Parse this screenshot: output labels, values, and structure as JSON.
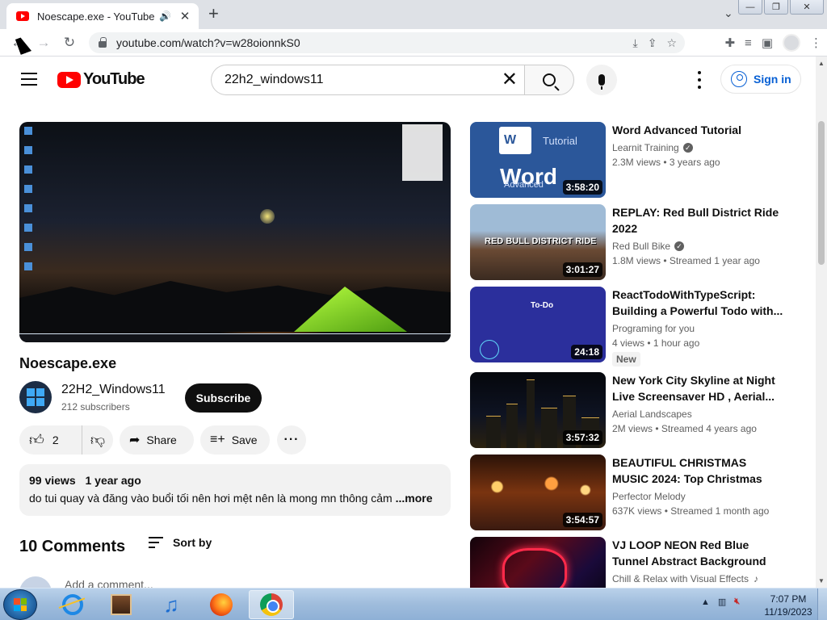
{
  "browser": {
    "tab_title": "Noescape.exe - YouTube",
    "url": "youtube.com/watch?v=w28oionnkS0"
  },
  "youtube": {
    "logo_text": "YouTube",
    "search_value": "22h2_windows11",
    "signin_label": "Sign in"
  },
  "video": {
    "title": "Noescape.exe",
    "channel_name": "22H2_Windows11",
    "subscribers": "212 subscribers",
    "subscribe_label": "Subscribe",
    "likes": "2",
    "share_label": "Share",
    "save_label": "Save",
    "views": "99 views",
    "age": "1 year ago",
    "description": "do tui quay và đăng vào buổi tối nên hơi mệt nên là mong mn thông cảm",
    "more_label": "...more"
  },
  "comments": {
    "count_label": "10 Comments",
    "sort_label": "Sort by",
    "add_placeholder": "Add a comment..."
  },
  "suggestions": [
    {
      "title": "Word Advanced Tutorial",
      "channel": "Learnit Training",
      "verified": true,
      "stats": "2.3M views  •  3 years ago",
      "duration": "3:58:20",
      "thumb_text": "Word",
      "thumb_sub": "Advanced",
      "thumb_tag": "Tutorial"
    },
    {
      "title": "REPLAY: Red Bull District Ride 2022",
      "channel": "Red Bull Bike",
      "verified": true,
      "stats": "1.8M views  •  Streamed 1 year ago",
      "duration": "3:01:27",
      "thumb_text": "RED BULL DISTRICT RIDE"
    },
    {
      "title": "ReactTodoWithTypeScript: Building a Powerful Todo with...",
      "channel": "Programing for you",
      "verified": false,
      "stats": "4 views  •  1 hour ago",
      "badge": "New",
      "duration": "24:18",
      "thumb_text": "To-Do"
    },
    {
      "title": "New York City Skyline at Night Live Screensaver HD , Aerial...",
      "channel": "Aerial Landscapes",
      "verified": false,
      "stats": "2M views  •  Streamed 4 years ago",
      "duration": "3:57:32"
    },
    {
      "title": "BEAUTIFUL CHRISTMAS MUSIC 2024: Top Christmas Songs of...",
      "channel": "Perfector Melody",
      "verified": false,
      "stats": "637K views  •  Streamed 1 month ago",
      "duration": "3:54:57"
    },
    {
      "title": "VJ LOOP NEON Red Blue Tunnel Abstract Background Video...",
      "channel": "Chill & Relax with Visual Effects",
      "verified": false,
      "stats": "",
      "duration": ""
    }
  ],
  "taskbar": {
    "time": "7:07 PM",
    "date": "11/19/2023"
  }
}
